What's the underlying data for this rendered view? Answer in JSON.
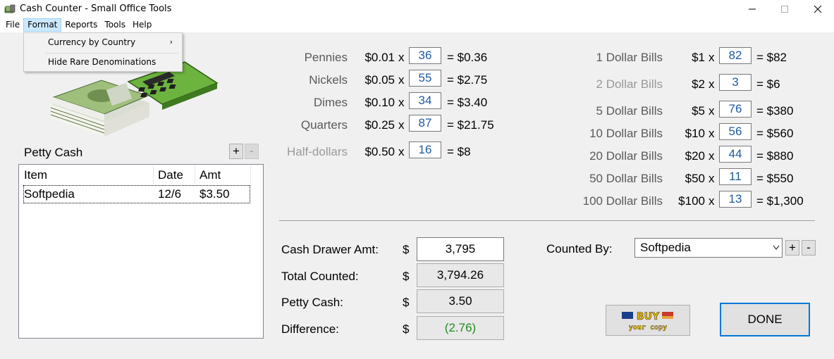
{
  "window": {
    "title": "Cash Counter - Small Office Tools"
  },
  "menu": {
    "file": "File",
    "format": "Format",
    "reports": "Reports",
    "tools": "Tools",
    "help": "Help"
  },
  "format_menu": {
    "currency_by_country": "Currency by Country",
    "hide_rare": "Hide Rare Denominations",
    "submenu_arrow": "›"
  },
  "petty_cash": {
    "title": "Petty Cash",
    "add": "+",
    "remove": "-",
    "columns": {
      "item": "Item",
      "date": "Date",
      "amt": "Amt"
    },
    "rows": [
      {
        "item": "Softpedia",
        "date": "12/6",
        "amt": "$3.50"
      }
    ]
  },
  "coins": [
    {
      "label": "Pennies",
      "unit": "$0.01",
      "x": "x",
      "count": "36",
      "result": "= $0.36",
      "muted": false
    },
    {
      "label": "Nickels",
      "unit": "$0.05",
      "x": "x",
      "count": "55",
      "result": "= $2.75",
      "muted": false
    },
    {
      "label": "Dimes",
      "unit": "$0.10",
      "x": "x",
      "count": "34",
      "result": "= $3.40",
      "muted": false
    },
    {
      "label": "Quarters",
      "unit": "$0.25",
      "x": "x",
      "count": "87",
      "result": "= $21.75",
      "muted": false
    },
    {
      "label": "Half-dollars",
      "unit": "$0.50",
      "x": "x",
      "count": "16",
      "result": "= $8",
      "muted": true
    }
  ],
  "bills": [
    {
      "label": "1 Dollar Bills",
      "unit": "$1",
      "x": "x",
      "count": "82",
      "result": "= $82",
      "muted": false
    },
    {
      "label": "2 Dollar Bills",
      "unit": "$2",
      "x": "x",
      "count": "3",
      "result": "= $6",
      "muted": true
    },
    {
      "label": "5 Dollar Bills",
      "unit": "$5",
      "x": "x",
      "count": "76",
      "result": "= $380",
      "muted": false
    },
    {
      "label": "10 Dollar Bills",
      "unit": "$10",
      "x": "x",
      "count": "56",
      "result": "= $560",
      "muted": false
    },
    {
      "label": "20 Dollar Bills",
      "unit": "$20",
      "x": "x",
      "count": "44",
      "result": "= $880",
      "muted": false
    },
    {
      "label": "50 Dollar Bills",
      "unit": "$50",
      "x": "x",
      "count": "11",
      "result": "= $550",
      "muted": false
    },
    {
      "label": "100 Dollar Bills",
      "unit": "$100",
      "x": "x",
      "count": "13",
      "result": "= $1,300",
      "muted": false
    }
  ],
  "totals": {
    "drawer_label": "Cash Drawer Amt:",
    "drawer_value": "3,795",
    "counted_label": "Total Counted:",
    "counted_value": "3,794.26",
    "petty_label": "Petty Cash:",
    "petty_value": "3.50",
    "diff_label": "Difference:",
    "diff_value": "(2.76)",
    "dollar": "$"
  },
  "counted_by": {
    "label": "Counted By:",
    "value": "Softpedia",
    "add": "+",
    "remove": "-"
  },
  "buy": {
    "line1": "BUY",
    "line2": "your copy"
  },
  "done": {
    "label": "DONE"
  },
  "colors": {
    "input_text": "#1e5aa0",
    "difference": "#228b22",
    "accent": "#0078d7"
  }
}
